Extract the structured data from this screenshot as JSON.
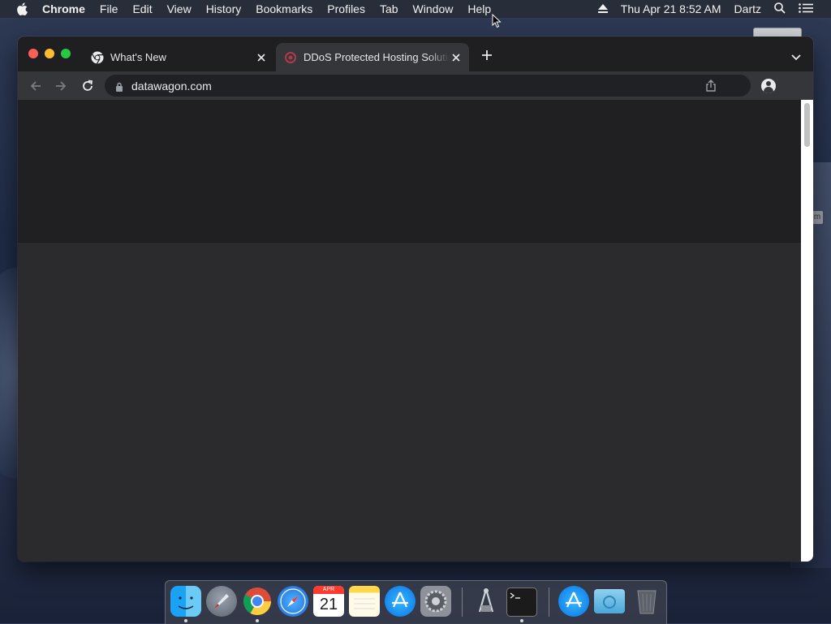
{
  "menubar": {
    "app_name": "Chrome",
    "items": [
      "File",
      "Edit",
      "View",
      "History",
      "Bookmarks",
      "Profiles",
      "Tab",
      "Window",
      "Help"
    ],
    "datetime": "Thu Apr 21  8:52 AM",
    "user": "Dartz"
  },
  "browser": {
    "tabs": [
      {
        "title": "What's New",
        "icon": "chrome-icon",
        "active": false
      },
      {
        "title": "DDoS Protected Hosting Solutions",
        "icon": "datawagon-favicon",
        "active": true
      }
    ],
    "url": "datawagon.com"
  },
  "desktop": {
    "side_label": "m"
  },
  "dock": {
    "calendar_month": "APR",
    "calendar_day": "21",
    "items": [
      "finder-icon",
      "launchpad-icon",
      "chrome-icon",
      "safari-icon",
      "calendar-icon",
      "notes-icon",
      "app-store-icon",
      "system-preferences-icon",
      "script-editor-icon",
      "terminal-icon",
      "app-store-download-icon",
      "downloads-folder-icon",
      "trash-icon"
    ]
  },
  "colors": {
    "accent_red": "#fe5f57",
    "accent_yellow": "#febc2e",
    "accent_green": "#28c840",
    "toolbar": "#35363a",
    "tabstrip": "#1f1f21"
  }
}
